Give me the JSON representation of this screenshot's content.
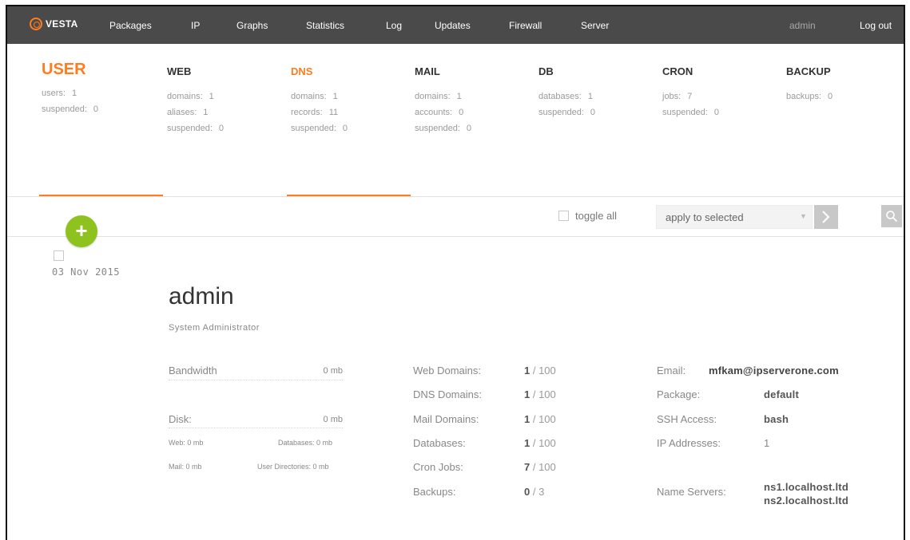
{
  "brand": {
    "name": "VESTA",
    "accent": "#ff7c1f"
  },
  "nav": {
    "items": [
      {
        "label": "Packages"
      },
      {
        "label": "IP"
      },
      {
        "label": "Graphs"
      },
      {
        "label": "Statistics"
      },
      {
        "label": "Log"
      },
      {
        "label": "Updates"
      },
      {
        "label": "Firewall"
      },
      {
        "label": "Server"
      }
    ],
    "user": "admin",
    "logout": "Log out"
  },
  "stats": {
    "user": {
      "title": "USER",
      "rows": [
        {
          "label": "users:",
          "value": "1"
        },
        {
          "label": "suspended:",
          "value": "0"
        }
      ]
    },
    "web": {
      "title": "WEB",
      "rows": [
        {
          "label": "domains:",
          "value": "1"
        },
        {
          "label": "aliases:",
          "value": "1"
        },
        {
          "label": "suspended:",
          "value": "0"
        }
      ]
    },
    "dns": {
      "title": "DNS",
      "rows": [
        {
          "label": "domains:",
          "value": "1"
        },
        {
          "label": "records:",
          "value": "11"
        },
        {
          "label": "suspended:",
          "value": "0"
        }
      ]
    },
    "mail": {
      "title": "MAIL",
      "rows": [
        {
          "label": "domains:",
          "value": "1"
        },
        {
          "label": "accounts:",
          "value": "0"
        },
        {
          "label": "suspended:",
          "value": "0"
        }
      ]
    },
    "db": {
      "title": "DB",
      "rows": [
        {
          "label": "databases:",
          "value": "1"
        },
        {
          "label": "suspended:",
          "value": "0"
        }
      ]
    },
    "cron": {
      "title": "CRON",
      "rows": [
        {
          "label": "jobs:",
          "value": "7"
        },
        {
          "label": "suspended:",
          "value": "0"
        }
      ]
    },
    "backup": {
      "title": "BACKUP",
      "rows": [
        {
          "label": "backups:",
          "value": "0"
        }
      ]
    }
  },
  "toolbar": {
    "toggle_all": "toggle all",
    "apply_selected": "apply to selected"
  },
  "user_entry": {
    "date": "03 Nov 2015",
    "name": "admin",
    "role": "System Administrator",
    "bandwidth_label": "Bandwidth",
    "bandwidth_value": "0 mb",
    "disk_label": "Disk:",
    "disk_value": "0 mb",
    "web": "Web: 0 mb",
    "databases": "Databases: 0 mb",
    "mail": "Mail: 0 mb",
    "user_dirs": "User Directories: 0 mb",
    "metrics": [
      {
        "label": "Web Domains:",
        "used": "1",
        "limit": " / 100"
      },
      {
        "label": "DNS Domains:",
        "used": "1",
        "limit": " / 100"
      },
      {
        "label": "Mail Domains:",
        "used": "1",
        "limit": " / 100"
      },
      {
        "label": "Databases:",
        "used": "1",
        "limit": " / 100"
      },
      {
        "label": "Cron Jobs:",
        "used": "7",
        "limit": " / 100"
      },
      {
        "label": "Backups:",
        "used": "0",
        "limit": " / 3"
      }
    ],
    "email_label": "Email:",
    "email": "mfkam@ipserverone.com",
    "package_label": "Package:",
    "package": "default",
    "ssh_label": "SSH Access:",
    "ssh": "bash",
    "ip_label": "IP Addresses:",
    "ip": "1",
    "ns_label": "Name Servers:",
    "ns1": "ns1.localhost.ltd",
    "ns2": "ns2.localhost.ltd"
  }
}
